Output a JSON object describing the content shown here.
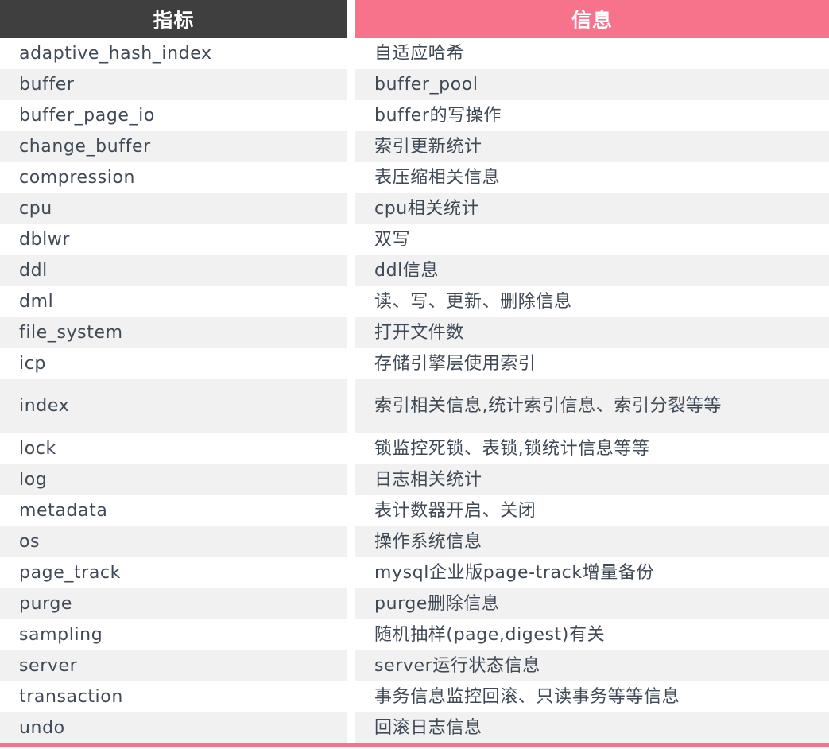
{
  "table": {
    "headers": {
      "metric": "指标",
      "info": "信息"
    },
    "colors": {
      "metric_header_bg": "#3f3f3f",
      "info_header_bg": "#f7738c",
      "header_text": "#ffffff",
      "stripe_bg": "#f1f1f1",
      "row_bg": "#ffffff",
      "body_text": "#3f4a56",
      "bottom_rule": "#f7738c"
    },
    "rows": [
      {
        "metric": "adaptive_hash_index",
        "info": "自适应哈希"
      },
      {
        "metric": "buffer",
        "info": "buffer_pool"
      },
      {
        "metric": "buffer_page_io",
        "info": "buffer的写操作"
      },
      {
        "metric": "change_buffer",
        "info": "索引更新统计"
      },
      {
        "metric": "compression",
        "info": "表压缩相关信息"
      },
      {
        "metric": "cpu",
        "info": "cpu相关统计"
      },
      {
        "metric": "dblwr",
        "info": "双写"
      },
      {
        "metric": "ddl",
        "info": "ddl信息"
      },
      {
        "metric": "dml",
        "info": "读、写、更新、删除信息"
      },
      {
        "metric": "file_system",
        "info": "打开文件数"
      },
      {
        "metric": "icp",
        "info": "存储引擎层使用索引"
      },
      {
        "metric": "index",
        "info": "索引相关信息,统计索引信息、索引分裂等等",
        "tall": true
      },
      {
        "metric": "lock",
        "info": "锁监控死锁、表锁,锁统计信息等等"
      },
      {
        "metric": "log",
        "info": "日志相关统计"
      },
      {
        "metric": "metadata",
        "info": "表计数器开启、关闭"
      },
      {
        "metric": "os",
        "info": "操作系统信息"
      },
      {
        "metric": "page_track",
        "info": "mysql企业版page-track增量备份"
      },
      {
        "metric": "purge",
        "info": "purge删除信息"
      },
      {
        "metric": "sampling",
        "info": "随机抽样(page,digest)有关"
      },
      {
        "metric": "server",
        "info": "server运行状态信息"
      },
      {
        "metric": "transaction",
        "info": "事务信息监控回滚、只读事务等等信息"
      },
      {
        "metric": "undo",
        "info": "回滚日志信息"
      }
    ]
  }
}
